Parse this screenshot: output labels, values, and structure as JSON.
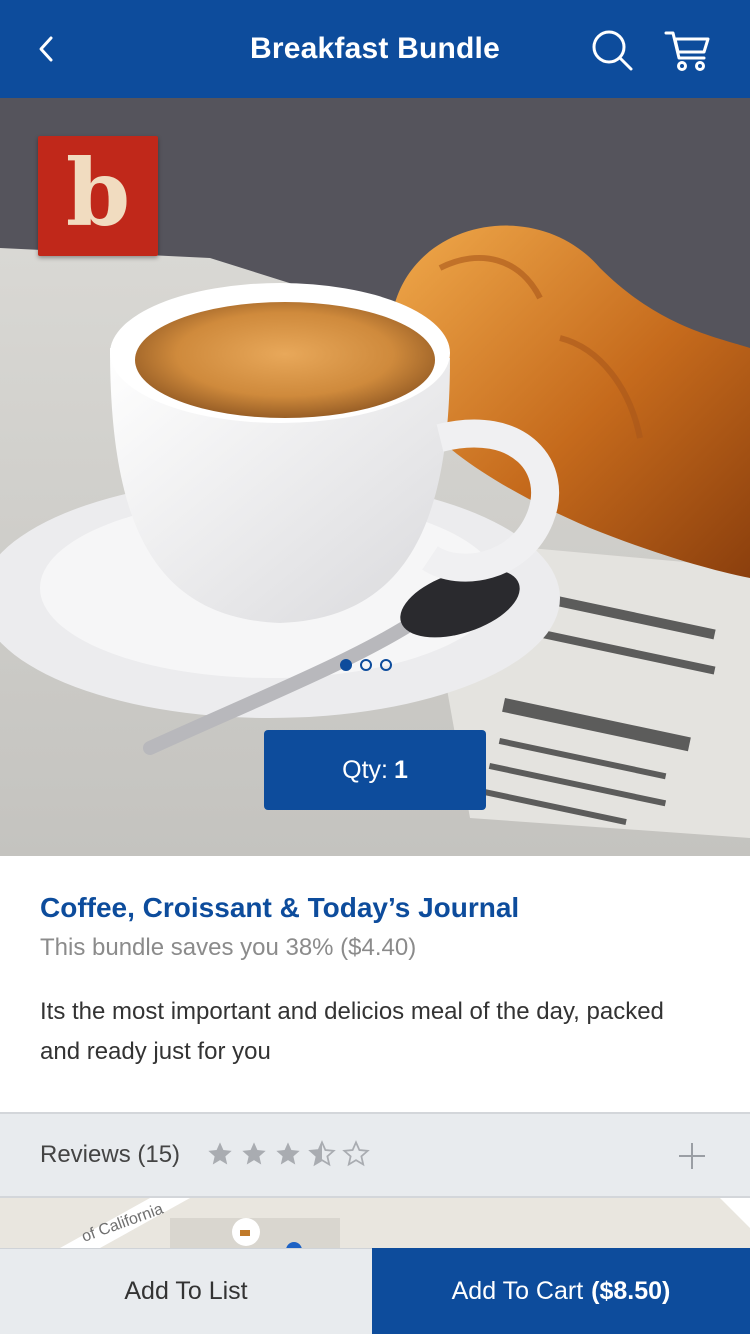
{
  "header": {
    "title": "Breakfast Bundle",
    "back_icon": "chevron-left-icon",
    "search_icon": "search-icon",
    "cart_icon": "cart-icon"
  },
  "hero": {
    "logo_letter": "b",
    "carousel": {
      "pages": 3,
      "active": 1
    },
    "qty_label": "Qty:",
    "qty_value": "1"
  },
  "product": {
    "title": "Coffee, Croissant & Today’s Journal",
    "savings": "This bundle saves you 38% ($4.40)",
    "description": "Its the most important and delicios meal of the day, packed and ready just for you"
  },
  "reviews": {
    "label": "Reviews (15)",
    "rating": 3.5,
    "max": 5,
    "expand_icon": "plus-icon"
  },
  "map": {
    "street_label": "of California"
  },
  "actions": {
    "add_to_list": "Add To List",
    "add_to_cart": "Add To Cart",
    "cart_price": "($8.50)"
  },
  "colors": {
    "brand_blue": "#0d4c9c",
    "logo_red": "#c0281a",
    "panel_gray": "#e8ebee"
  }
}
